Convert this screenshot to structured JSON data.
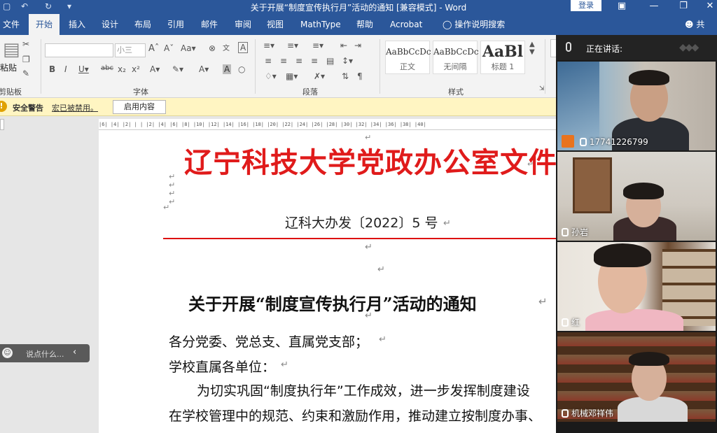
{
  "window": {
    "title": "关于开展“制度宣传执行月”活动的通知 [兼容模式] - Word",
    "login_label": "登录"
  },
  "tabs": [
    {
      "label": "文件"
    },
    {
      "label": "开始"
    },
    {
      "label": "插入"
    },
    {
      "label": "设计"
    },
    {
      "label": "布局"
    },
    {
      "label": "引用"
    },
    {
      "label": "邮件"
    },
    {
      "label": "审阅"
    },
    {
      "label": "视图"
    },
    {
      "label": "MathType"
    },
    {
      "label": "帮助"
    },
    {
      "label": "Acrobat"
    }
  ],
  "tell_me": "操作说明搜索",
  "share_label": "共享",
  "ribbon": {
    "paste_label": "粘贴",
    "groups": [
      "剪贴板",
      "字体",
      "段落",
      "样式"
    ],
    "font_size": "小三",
    "styles": [
      {
        "preview": "AaBbCcDc",
        "name": "正文"
      },
      {
        "preview": "AaBbCcDc",
        "name": "无间隔"
      },
      {
        "preview": "AaBl",
        "name": "标题 1"
      }
    ]
  },
  "security_bar": {
    "title": "安全警告",
    "message": "宏已被禁用。",
    "button": "启用内容"
  },
  "ruler_text": "|6| |4| |2| |  | |2| |4| |6| |8| |10| |12| |14| |16| |18| |20| |22| |24| |26| |28| |30| |32| |34| |36| |38| |40|",
  "chat_placeholder": "说点什么...",
  "document": {
    "header": "辽宁科技大学党政办公室文件",
    "number": "辽科大办发〔2022〕5 号",
    "title": "关于开展“制度宣传执行月”活动的通知",
    "lines": [
      "各分党委、党总支、直属党支部；",
      "学校直属各单位：",
      "为切实巩固“制度执行年”工作成效，进一步发挥制度建设",
      "在学校管理中的规范、约束和激励作用，推动建立按制度办事、"
    ],
    "return_mark": "↵"
  },
  "meeting": {
    "speaking_label": "正在讲话:",
    "participants": [
      {
        "name": "17741226799"
      },
      {
        "name": "孙岩"
      },
      {
        "name": "红"
      },
      {
        "name": "机械邓祥伟"
      }
    ]
  },
  "colors": {
    "word_blue": "#2b579a",
    "header_red": "#e01b1b",
    "warning_bg": "#fff5c2"
  }
}
